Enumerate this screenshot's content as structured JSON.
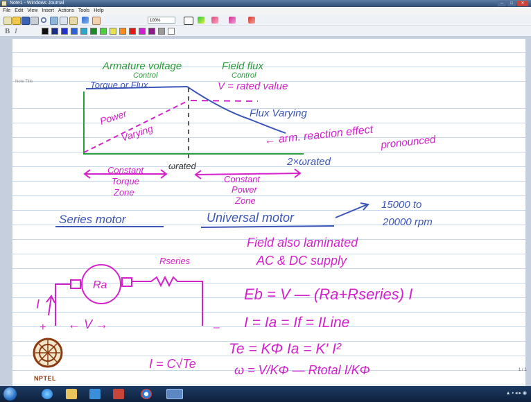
{
  "window": {
    "title": "Note1 - Windows Journal",
    "buttons": [
      "–",
      "□",
      "✕"
    ]
  },
  "menu": [
    "File",
    "Edit",
    "View",
    "Insert",
    "Actions",
    "Tools",
    "Help"
  ],
  "toolbar": {
    "zoom": "100%",
    "icons": [
      "new-icon",
      "open-icon",
      "save-icon",
      "print-icon",
      "search-icon",
      "cut-icon",
      "copy-icon",
      "paste-icon",
      "undo-icon",
      "hand-icon",
      "pen-icon",
      "highlighter-icon",
      "eraser-icon",
      "selection-icon",
      "insert-space-icon"
    ],
    "bold": "B",
    "italic": "I",
    "pen_colors": [
      "#111111",
      "#1e2c8c",
      "#2233cc",
      "#2b63d6",
      "#28a8cc",
      "#1c8a2a",
      "#4ad13d",
      "#e6e24a",
      "#ff8a1c",
      "#e21a1a",
      "#d21ed0",
      "#8b1a8b",
      "#9a9a9a",
      "#ffffff"
    ]
  },
  "note": {
    "title_label": "Note Title",
    "page_number": "1 / 1"
  },
  "ink": {
    "armature": "Armature voltage",
    "control1": "Control",
    "field_flux": "Field flux",
    "control2": "Control",
    "torque_flux": "Torque or Flux",
    "v_rated": "V = rated value",
    "power": "Power",
    "varying": "Varying",
    "flux_varying": "Flux Varying",
    "arm_reaction": "← arm. reaction effect",
    "pronounced": "pronounced",
    "w_rated": "ωrated",
    "two_w_rated": "2×ωrated",
    "constant_torque": "Constant",
    "torque": "Torque",
    "zone1": "Zone",
    "constant_power": "Constant",
    "power2": "Power",
    "zone2": "Zone",
    "series_motor": "Series motor",
    "universal_motor": "Universal motor",
    "rpm1": "15000 to",
    "rpm2": "20000 rpm",
    "field_laminated": "Field also laminated",
    "ac_dc": "AC & DC supply",
    "rseries": "Rseries",
    "ra": "Ra",
    "current_i": "I",
    "plus": "+",
    "minus": "–",
    "voltage": "← V →",
    "eq1": "Eb = V — (Ra+Rseries) I",
    "eq2": "I = Ia = If = ILine",
    "eq3": "Te = KΦ Ia = K′ I²",
    "eq4": "ω = V/KΦ — Rtotal I/KΦ",
    "eq5": "I = C√Te"
  },
  "logo": {
    "text": "NPTEL"
  },
  "taskbar": {
    "apps": [
      "start-orb",
      "ie-icon",
      "explorer-icon",
      "media-icon",
      "app-icon",
      "chrome-icon",
      "journal-icon"
    ],
    "tray": "▲ ▪ ◂ ▸ ◉"
  }
}
